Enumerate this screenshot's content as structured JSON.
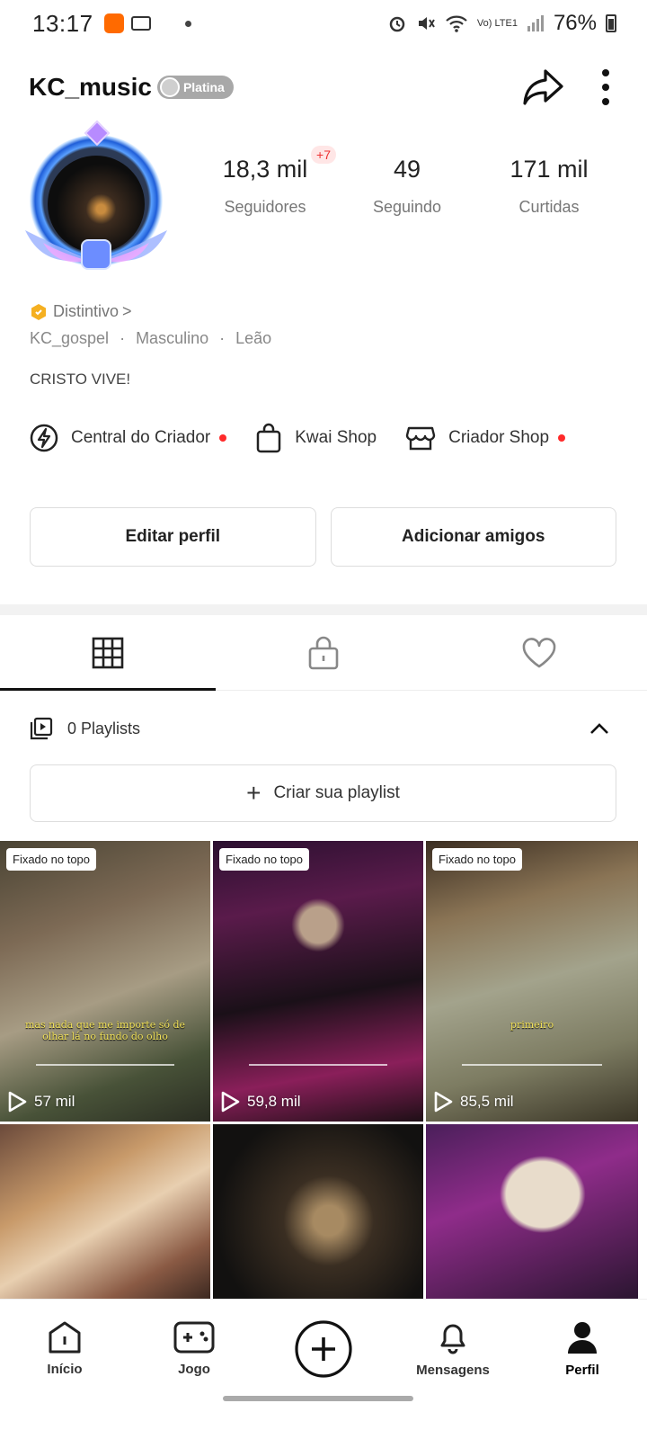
{
  "status": {
    "time": "13:17",
    "network_small": "Vo)\nLTE1",
    "battery": "76%"
  },
  "header": {
    "username": "KC_music",
    "badge": "Platina"
  },
  "stats": {
    "followers_value": "18,3 mil",
    "followers_label": "Seguidores",
    "followers_badge": "+7",
    "following_value": "49",
    "following_label": "Seguindo",
    "likes_value": "171 mil",
    "likes_label": "Curtidas"
  },
  "profile": {
    "distintivo": "Distintivo",
    "chevron": ">",
    "handle": "KC_gospel",
    "gender": "Masculino",
    "sign": "Leão",
    "separator": "·",
    "bio": "CRISTO VIVE!"
  },
  "shortcuts": [
    {
      "label": "Central do Criador"
    },
    {
      "label": "Kwai Shop"
    },
    {
      "label": "Criador Shop"
    }
  ],
  "buttons": {
    "edit": "Editar perfil",
    "add_friends": "Adicionar amigos"
  },
  "playlists": {
    "label": "0 Playlists",
    "create": "Criar sua playlist",
    "plus": "+"
  },
  "grid": {
    "pin_label": "Fixado no topo",
    "tiles": [
      {
        "views": "57 mil",
        "caption": "mas nada que me importe só de olhar lá no fundo do olho"
      },
      {
        "views": "59,8 mil",
        "caption": ""
      },
      {
        "views": "85,5 mil",
        "caption": "primeiro"
      }
    ]
  },
  "nav": {
    "home": "Início",
    "game": "Jogo",
    "messages": "Mensagens",
    "profile": "Perfil"
  }
}
